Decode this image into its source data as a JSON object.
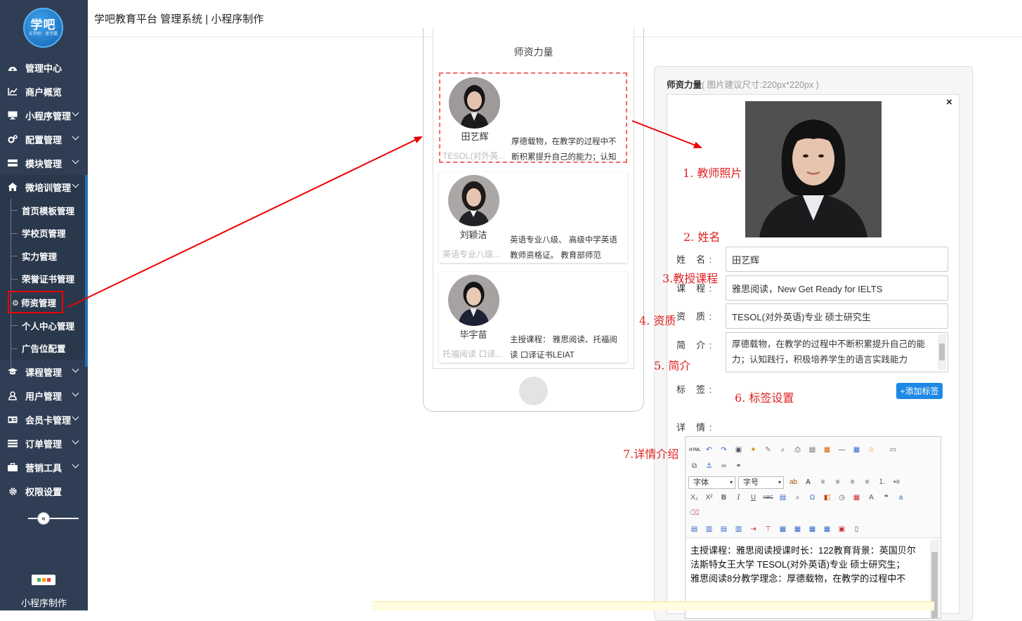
{
  "app": {
    "logo_text": "学吧",
    "logo_subtext": "乐学吧 · 变学霸",
    "title": "学吧教育平台 管理系统 | 小程序制作"
  },
  "sidebar": {
    "items": [
      {
        "label": "管理中心",
        "icon": "dashboard-icon",
        "chevron": false
      },
      {
        "label": "商户概览",
        "icon": "line-chart-icon",
        "chevron": false
      },
      {
        "label": "小程序管理",
        "icon": "monitor-icon",
        "chevron": true
      },
      {
        "label": "配置管理",
        "icon": "gears-icon",
        "chevron": true
      },
      {
        "label": "模块管理",
        "icon": "server-icon",
        "chevron": true
      },
      {
        "label": "微培训管理",
        "icon": "home-icon",
        "chevron": true
      }
    ],
    "submenu": [
      "首页模板管理",
      "学校页管理",
      "实力管理",
      "荣誉证书管理",
      "师资管理",
      "个人中心管理",
      "广告位配置"
    ],
    "items_after": [
      {
        "label": "课程管理",
        "icon": "graduation-cap-icon"
      },
      {
        "label": "用户管理",
        "icon": "user-icon"
      },
      {
        "label": "会员卡管理",
        "icon": "id-card-icon"
      },
      {
        "label": "订单管理",
        "icon": "list-icon"
      },
      {
        "label": "营销工具",
        "icon": "briefcase-icon"
      },
      {
        "label": "权限设置",
        "icon": "gear-icon"
      }
    ],
    "footer_label": "小程序制作"
  },
  "preview": {
    "title": "师资力量",
    "teachers": [
      {
        "name": "田艺辉",
        "qual": "TESOL(对外英...",
        "desc": "厚德载物，在教学的过程中不断积累提升自己的能力；认知"
      },
      {
        "name": "刘颖洁",
        "qual": "英语专业八级...",
        "desc": "英语专业八级、 高级中学英语教师资格证。 教育部师范"
      },
      {
        "name": "毕宇苗",
        "qual": "托福阅读 口译...",
        "desc": "主授课程： 雅思阅读、托福阅读 口译证书LEIAT"
      }
    ]
  },
  "editor": {
    "title": "师资力量",
    "hint": "( 图片建议尺寸:220px*220px )",
    "close": "×",
    "fields": {
      "name_label": "姓　名 :",
      "name_value": "田艺辉",
      "course_label": "课　程 :",
      "course_value": "雅思阅读，New Get Ready for IELTS",
      "qual_label": "资　质 :",
      "qual_value": "TESOL(对外英语)专业 硕士研究生",
      "intro_label": "简　介 :",
      "intro_value": "厚德载物，在教学的过程中不断积累提升自己的能力；认知践行，积极培养学生的语言实践能力",
      "tag_label": "标　签 :",
      "tag_button": "+添加标签",
      "detail_label": "详　情 :"
    },
    "ue": {
      "font_select": "字体",
      "size_select": "字号",
      "html_btn": "HTML",
      "content": "主授课程：雅思阅读授课时长：122教育背景：英国贝尔法斯特女王大学 TESOL(对外英语)专业 硕士研究生；\n雅思阅读8分教学理念：厚德载物，在教学的过程中不"
    }
  },
  "annotations": [
    "1. 教师照片",
    "2. 姓名",
    "3.教授课程",
    "4. 资质",
    "5. 简介",
    "6. 标签设置",
    "7.详情介绍"
  ],
  "colors": {
    "sidebar_bg": "#2f3e54",
    "accent": "#1e88e5",
    "annotation": "#e02020"
  }
}
